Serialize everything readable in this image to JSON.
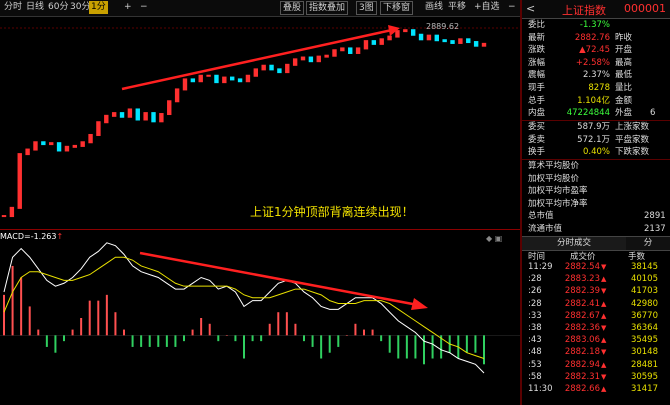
{
  "toolbar": {
    "left_items": [
      "分时",
      "日线",
      "60分",
      "30分",
      "1分",
      "+",
      "−"
    ],
    "active_item": "1分",
    "right_items": [
      "叠股",
      "指数叠加",
      "3图",
      "下移窗",
      "画线",
      "平移",
      "+自选",
      "−"
    ]
  },
  "price_chart": {
    "peak_label": "2889.62",
    "annotation": "上证1分钟顶部背离连续出现！"
  },
  "macd": {
    "label": "MACD=",
    "value": "-1.263",
    "arrow": "↑",
    "corner": "◆ ▣"
  },
  "chart_data": [
    {
      "type": "line",
      "title": "",
      "series": [
        {
          "name": "",
          "values": [
            2869.2,
            2870.1,
            2876.0,
            2876.5,
            2877.3,
            2877.1,
            2877.2,
            2876.4,
            2876.8,
            2876.9,
            2877.3,
            2878.1,
            2879.5,
            2880.2,
            2880.5,
            2880.1,
            2880.9,
            2879.8,
            2880.5,
            2879.6,
            2880.4,
            2881.8,
            2883.1,
            2884.2,
            2884.0,
            2884.6,
            2884.6,
            2883.9,
            2884.4,
            2884.2,
            2884.0,
            2884.6,
            2885.3,
            2885.7,
            2885.3,
            2885.0,
            2885.8,
            2886.4,
            2886.6,
            2886.2,
            2886.7,
            2886.8,
            2887.4,
            2887.6,
            2887.1,
            2887.6,
            2888.4,
            2888.1,
            2888.6,
            2888.9,
            2889.5,
            2889.6,
            2889.1,
            2888.6,
            2889.0,
            2888.5,
            2888.4,
            2888.2,
            2888.6,
            2888.3,
            2887.9,
            2888.1
          ]
        }
      ]
    },
    {
      "type": "line",
      "title": "",
      "ylabel": "MACD",
      "series": [
        {
          "name": "DIF",
          "values": [
            1.5,
            2.7,
            3.0,
            2.7,
            2.3,
            1.9,
            1.7,
            1.8,
            2.0,
            2.3,
            2.7,
            2.9,
            3.2,
            3.1,
            2.8,
            2.4,
            2.2,
            2.1,
            2.0,
            1.8,
            1.6,
            1.6,
            1.8,
            2.0,
            1.9,
            1.6,
            1.7,
            1.5,
            1.0,
            1.2,
            1.2,
            1.5,
            1.8,
            1.9,
            1.8,
            1.5,
            1.3,
            1.0,
            0.9,
            0.9,
            1.1,
            1.3,
            1.3,
            1.3,
            1.1,
            0.8,
            0.5,
            0.3,
            0.1,
            -0.2,
            -0.3,
            -0.5,
            -0.6,
            -0.8,
            -0.9,
            -1.0,
            -1.3
          ]
        },
        {
          "name": "DEA",
          "values": [
            0.8,
            1.5,
            2.0,
            2.2,
            2.2,
            2.1,
            2.0,
            1.9,
            1.9,
            2.0,
            2.1,
            2.3,
            2.5,
            2.7,
            2.7,
            2.6,
            2.4,
            2.3,
            2.2,
            2.0,
            1.8,
            1.7,
            1.7,
            1.7,
            1.7,
            1.7,
            1.7,
            1.6,
            1.4,
            1.3,
            1.3,
            1.3,
            1.4,
            1.5,
            1.6,
            1.6,
            1.5,
            1.4,
            1.2,
            1.1,
            1.1,
            1.1,
            1.2,
            1.2,
            1.2,
            1.1,
            0.9,
            0.7,
            0.5,
            0.3,
            0.1,
            -0.1,
            -0.3,
            -0.4,
            -0.6,
            -0.7,
            -0.8
          ]
        }
      ]
    }
  ],
  "right_panel": {
    "back": "<",
    "name": "上证指数",
    "code": "000001",
    "stats": [
      {
        "k": "委比",
        "v": "-1.37%",
        "vc": "green",
        "k2": "",
        "v2": ""
      },
      {
        "k": "最新",
        "v": "2882.76",
        "vc": "red",
        "k2": "昨收",
        "v2": ""
      },
      {
        "k": "涨跌",
        "v": "▲72.45",
        "vc": "red",
        "k2": "开盘",
        "v2": ""
      },
      {
        "k": "涨幅",
        "v": "+2.58%",
        "vc": "red",
        "k2": "最高",
        "v2": ""
      },
      {
        "k": "震幅",
        "v": "2.37%",
        "vc": "white",
        "k2": "最低",
        "v2": ""
      },
      {
        "k": "现手",
        "v": "8278",
        "vc": "yellow",
        "k2": "量比",
        "v2": ""
      },
      {
        "k": "总手",
        "v": "1.104亿",
        "vc": "yellow",
        "k2": "金额",
        "v2": ""
      },
      {
        "k": "内盘",
        "v": "47224844",
        "vc": "green",
        "k2": "外盘",
        "v2": "6"
      }
    ],
    "stats2": [
      {
        "k": "委买",
        "v": "587.9万",
        "vc": "white",
        "k2": "上涨家数"
      },
      {
        "k": "委卖",
        "v": "572.1万",
        "vc": "white",
        "k2": "平盘家数"
      },
      {
        "k": "换手",
        "v": "0.40%",
        "vc": "yellow",
        "k2": "下跌家数"
      }
    ],
    "extra": [
      {
        "k": "算术平均股价",
        "v": ""
      },
      {
        "k": "加权平均股价",
        "v": ""
      },
      {
        "k": "加权平均市盈率",
        "v": ""
      },
      {
        "k": "加权平均市净率",
        "v": ""
      },
      {
        "k": "总市值",
        "v": "2891"
      },
      {
        "k": "流通市值",
        "v": "2137"
      }
    ],
    "tabs": {
      "active": "分时成交",
      "other": "分"
    },
    "headers": [
      "时间",
      "成交价",
      "手数"
    ],
    "trades": [
      {
        "t": "11:29",
        "p": "2882.54",
        "a": "▼",
        "ac": "green",
        "v": "38145"
      },
      {
        "t": ":28",
        "p": "2883.23",
        "a": "▲",
        "ac": "red",
        "v": "40105"
      },
      {
        "t": ":26",
        "p": "2882.39",
        "a": "▼",
        "ac": "green",
        "v": "41703"
      },
      {
        "t": ":28",
        "p": "2882.41",
        "a": "▲",
        "ac": "red",
        "v": "42980"
      },
      {
        "t": ":33",
        "p": "2882.67",
        "a": "▲",
        "ac": "red",
        "v": "36770"
      },
      {
        "t": ":38",
        "p": "2882.36",
        "a": "▼",
        "ac": "green",
        "v": "36364"
      },
      {
        "t": ":43",
        "p": "2883.06",
        "a": "▲",
        "ac": "red",
        "v": "35495"
      },
      {
        "t": ":48",
        "p": "2882.18",
        "a": "▼",
        "ac": "green",
        "v": "30148"
      },
      {
        "t": ":53",
        "p": "2882.94",
        "a": "▲",
        "ac": "red",
        "v": "28481"
      },
      {
        "t": ":58",
        "p": "2882.31",
        "a": "▼",
        "ac": "green",
        "v": "30595"
      },
      {
        "t": "11:30",
        "p": "2882.66",
        "a": "▲",
        "ac": "red",
        "v": "31417"
      }
    ]
  }
}
